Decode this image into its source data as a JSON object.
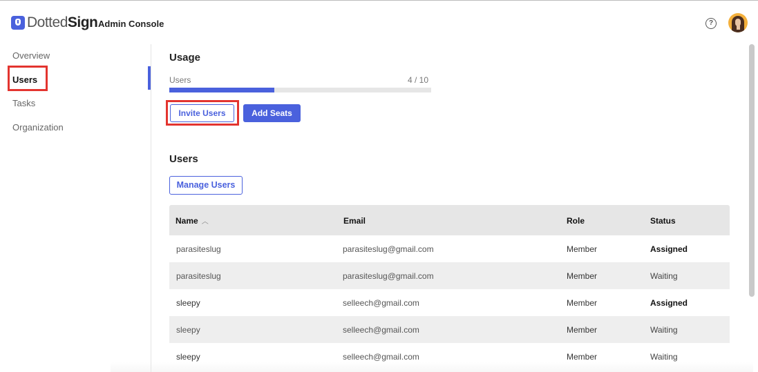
{
  "app": {
    "logo_thin": "Dotted",
    "logo_bold": "Sign",
    "title": "Admin Console",
    "help_glyph": "?"
  },
  "sidebar": {
    "items": [
      {
        "label": "Overview",
        "active": false
      },
      {
        "label": "Users",
        "active": true
      },
      {
        "label": "Tasks",
        "active": false
      },
      {
        "label": "Organization",
        "active": false
      }
    ]
  },
  "usage": {
    "title": "Usage",
    "label": "Users",
    "count_text": "4 / 10",
    "used": 4,
    "total": 10,
    "invite_label": "Invite Users",
    "add_seats_label": "Add Seats"
  },
  "users_section": {
    "title": "Users",
    "manage_label": "Manage Users",
    "columns": {
      "name": "Name",
      "email": "Email",
      "role": "Role",
      "status": "Status"
    },
    "rows": [
      {
        "name": "parasiteslug",
        "email": "parasiteslug@gmail.com",
        "role": "Member",
        "status": "Assigned"
      },
      {
        "name": "parasiteslug",
        "email": "parasiteslug@gmail.com",
        "role": "Member",
        "status": "Waiting"
      },
      {
        "name": "sleepy",
        "email": "selleech@gmail.com",
        "role": "Member",
        "status": "Assigned"
      },
      {
        "name": "sleepy",
        "email": "selleech@gmail.com",
        "role": "Member",
        "status": "Waiting"
      },
      {
        "name": "sleepy",
        "email": "selleech@gmail.com",
        "role": "Member",
        "status": "Waiting"
      }
    ]
  },
  "colors": {
    "accent": "#4a61dd",
    "highlight": "#e3342f"
  },
  "icons": {
    "logo": "dottedsign-logo-icon",
    "help": "help-circle-icon",
    "sort": "chevron-up-icon",
    "avatar": "user-avatar"
  }
}
